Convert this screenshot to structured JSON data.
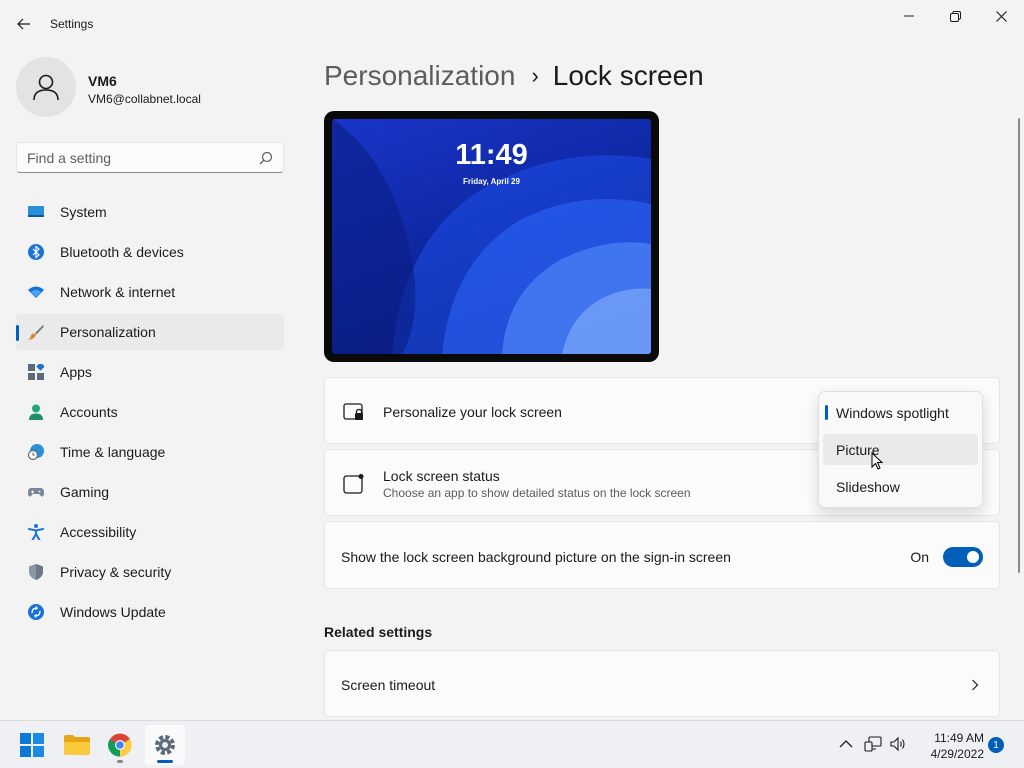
{
  "window": {
    "title": "Settings",
    "controls": {
      "minimize": "minimize-icon",
      "restore": "restore-icon",
      "close": "close-icon"
    }
  },
  "user": {
    "name": "VM6",
    "email": "VM6@collabnet.local"
  },
  "search": {
    "placeholder": "Find a setting"
  },
  "sidebar": {
    "items": [
      {
        "label": "System",
        "icon": "system-icon"
      },
      {
        "label": "Bluetooth & devices",
        "icon": "bluetooth-icon"
      },
      {
        "label": "Network & internet",
        "icon": "wifi-icon"
      },
      {
        "label": "Personalization",
        "icon": "brush-icon",
        "active": true
      },
      {
        "label": "Apps",
        "icon": "apps-icon"
      },
      {
        "label": "Accounts",
        "icon": "accounts-icon"
      },
      {
        "label": "Time & language",
        "icon": "clock-globe-icon"
      },
      {
        "label": "Gaming",
        "icon": "gamepad-icon"
      },
      {
        "label": "Accessibility",
        "icon": "accessibility-icon"
      },
      {
        "label": "Privacy & security",
        "icon": "shield-icon"
      },
      {
        "label": "Windows Update",
        "icon": "update-icon"
      }
    ]
  },
  "breadcrumb": {
    "parent": "Personalization",
    "separator": "›",
    "current": "Lock screen"
  },
  "preview": {
    "time": "11:49",
    "date": "Friday, April 29"
  },
  "settings": {
    "personalize": {
      "title": "Personalize your lock screen"
    },
    "status": {
      "title": "Lock screen status",
      "description": "Choose an app to show detailed status on the lock screen"
    },
    "signin_bg": {
      "title": "Show the lock screen background picture on the sign-in screen",
      "state": "On",
      "enabled": true
    }
  },
  "dropdown": {
    "options": [
      "Windows spotlight",
      "Picture",
      "Slideshow"
    ],
    "selected": "Windows spotlight",
    "hovered": "Picture"
  },
  "related": {
    "heading": "Related settings",
    "items": [
      {
        "label": "Screen timeout"
      }
    ]
  },
  "taskbar": {
    "clock_time": "11:49 AM",
    "clock_date": "4/29/2022",
    "notification_count": "1"
  },
  "colors": {
    "accent": "#005fb8",
    "background": "#f3f3f3",
    "card": "#fbfbfb"
  }
}
